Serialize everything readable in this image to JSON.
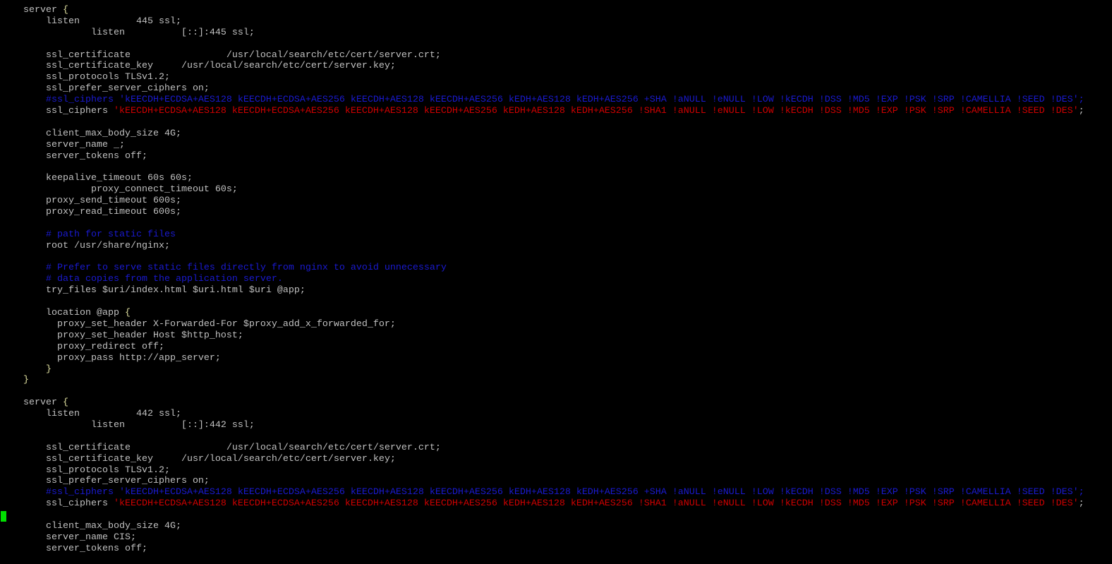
{
  "terminal": {
    "colors": {
      "default": "#c0c0c0",
      "comment": "#1a1ad0",
      "string": "#d00000",
      "cursor": "#00e000",
      "background": "#000000"
    },
    "cursor_line": 46,
    "lines": [
      [
        {
          "t": "    server ",
          "c": "def"
        },
        {
          "t": "{",
          "c": "brace"
        }
      ],
      [
        {
          "t": "        listen          445 ssl;",
          "c": "def"
        }
      ],
      [
        {
          "t": "                listen          [::]:445 ssl;",
          "c": "def"
        }
      ],
      [],
      [
        {
          "t": "        ssl_certificate                 /usr/local/search/etc/cert/server.crt;",
          "c": "def"
        }
      ],
      [
        {
          "t": "        ssl_certificate_key     /usr/local/search/etc/cert/server.key;",
          "c": "def"
        }
      ],
      [
        {
          "t": "        ssl_protocols TLSv1.2;",
          "c": "def"
        }
      ],
      [
        {
          "t": "        ssl_prefer_server_ciphers on;",
          "c": "def"
        }
      ],
      [
        {
          "t": "        #ssl_ciphers 'kEECDH+ECDSA+AES128 kEECDH+ECDSA+AES256 kEECDH+AES128 kEECDH+AES256 kEDH+AES128 kEDH+AES256 +SHA !aNULL !eNULL !LOW !kECDH !DSS !MD5 !EXP !PSK !SRP !CAMELLIA !SEED !DES';",
          "c": "comment"
        }
      ],
      [
        {
          "t": "        ssl_ciphers ",
          "c": "def"
        },
        {
          "t": "'kEECDH+ECDSA+AES128 kEECDH+ECDSA+AES256 kEECDH+AES128 kEECDH+AES256 kEDH+AES128 kEDH+AES256 !SHA1 !aNULL !eNULL !LOW !kECDH !DSS !MD5 !EXP !PSK !SRP !CAMELLIA !SEED !DES'",
          "c": "string"
        },
        {
          "t": ";",
          "c": "def"
        }
      ],
      [],
      [
        {
          "t": "        client_max_body_size 4G;",
          "c": "def"
        }
      ],
      [
        {
          "t": "        server_name _;",
          "c": "def"
        }
      ],
      [
        {
          "t": "        server_tokens off;",
          "c": "def"
        }
      ],
      [],
      [
        {
          "t": "        keepalive_timeout 60s 60s;",
          "c": "def"
        }
      ],
      [
        {
          "t": "                proxy_connect_timeout 60s;",
          "c": "def"
        }
      ],
      [
        {
          "t": "        proxy_send_timeout 600s;",
          "c": "def"
        }
      ],
      [
        {
          "t": "        proxy_read_timeout 600s;",
          "c": "def"
        }
      ],
      [],
      [
        {
          "t": "        # path for static files",
          "c": "comment"
        }
      ],
      [
        {
          "t": "        root /usr/share/nginx;",
          "c": "def"
        }
      ],
      [],
      [
        {
          "t": "        # Prefer to serve static files directly from nginx to avoid unnecessary",
          "c": "comment"
        }
      ],
      [
        {
          "t": "        # data copies from the application server.",
          "c": "comment"
        }
      ],
      [
        {
          "t": "        try_files $uri/index.html $uri.html $uri @app;",
          "c": "def"
        }
      ],
      [],
      [
        {
          "t": "        location @app ",
          "c": "def"
        },
        {
          "t": "{",
          "c": "brace"
        }
      ],
      [
        {
          "t": "          proxy_set_header X-Forwarded-For $proxy_add_x_forwarded_for;",
          "c": "def"
        }
      ],
      [
        {
          "t": "          proxy_set_header Host $http_host;",
          "c": "def"
        }
      ],
      [
        {
          "t": "          proxy_redirect off;",
          "c": "def"
        }
      ],
      [
        {
          "t": "          proxy_pass http://app_server;",
          "c": "def"
        }
      ],
      [
        {
          "t": "        ",
          "c": "def"
        },
        {
          "t": "}",
          "c": "brace"
        }
      ],
      [
        {
          "t": "    ",
          "c": "def"
        },
        {
          "t": "}",
          "c": "brace"
        }
      ],
      [],
      [
        {
          "t": "    server ",
          "c": "def"
        },
        {
          "t": "{",
          "c": "brace"
        }
      ],
      [
        {
          "t": "        listen          442 ssl;",
          "c": "def"
        }
      ],
      [
        {
          "t": "                listen          [::]:442 ssl;",
          "c": "def"
        }
      ],
      [],
      [
        {
          "t": "        ssl_certificate                 /usr/local/search/etc/cert/server.crt;",
          "c": "def"
        }
      ],
      [
        {
          "t": "        ssl_certificate_key     /usr/local/search/etc/cert/server.key;",
          "c": "def"
        }
      ],
      [
        {
          "t": "        ssl_protocols TLSv1.2;",
          "c": "def"
        }
      ],
      [
        {
          "t": "        ssl_prefer_server_ciphers on;",
          "c": "def"
        }
      ],
      [
        {
          "t": "        #ssl_ciphers 'kEECDH+ECDSA+AES128 kEECDH+ECDSA+AES256 kEECDH+AES128 kEECDH+AES256 kEDH+AES128 kEDH+AES256 +SHA !aNULL !eNULL !LOW !kECDH !DSS !MD5 !EXP !PSK !SRP !CAMELLIA !SEED !DES';",
          "c": "comment"
        }
      ],
      [
        {
          "t": "        ssl_ciphers ",
          "c": "def"
        },
        {
          "t": "'kEECDH+ECDSA+AES128 kEECDH+ECDSA+AES256 kEECDH+AES128 kEECDH+AES256 kEDH+AES128 kEDH+AES256 !SHA1 !aNULL !eNULL !LOW !kECDH !DSS !MD5 !EXP !PSK !SRP !CAMELLIA !SEED !DES'",
          "c": "string"
        },
        {
          "t": ";",
          "c": "def"
        }
      ],
      [],
      [
        {
          "t": "        client_max_body_size 4G;",
          "c": "def"
        }
      ],
      [
        {
          "t": "        server_name CIS;",
          "c": "def"
        }
      ],
      [
        {
          "t": "        server_tokens off;",
          "c": "def"
        }
      ]
    ]
  }
}
